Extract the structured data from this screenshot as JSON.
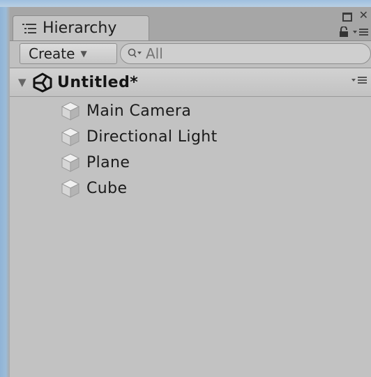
{
  "window": {
    "tab_label": "Hierarchy",
    "icons": {
      "tab": "list-icon",
      "maximize": "maximize-icon",
      "close": "close-icon",
      "lock": "lock-icon",
      "menu": "panel-menu-icon"
    }
  },
  "toolbar": {
    "create_label": "Create",
    "search_placeholder": "All"
  },
  "scene": {
    "name": "Untitled*"
  },
  "items": [
    {
      "label": "Main Camera",
      "icon": "gameobject-cube-icon"
    },
    {
      "label": "Directional Light",
      "icon": "gameobject-cube-icon"
    },
    {
      "label": "Plane",
      "icon": "gameobject-cube-icon"
    },
    {
      "label": "Cube",
      "icon": "gameobject-cube-icon"
    }
  ],
  "colors": {
    "panel_bg": "#c2c2c2",
    "tabbar_bg": "#a6a6a6",
    "frame_blue": "#9cbcd9"
  }
}
